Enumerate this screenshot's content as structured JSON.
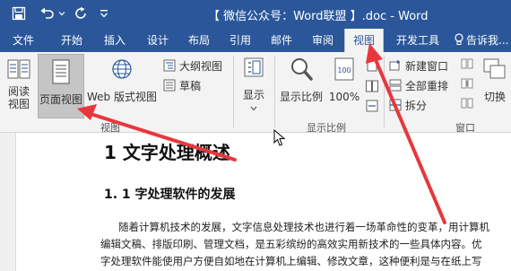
{
  "window": {
    "title": "【 微信公众号：Word联盟 】.doc - Word"
  },
  "tabs": [
    {
      "label": "文件"
    },
    {
      "label": "开始"
    },
    {
      "label": "插入"
    },
    {
      "label": "设计"
    },
    {
      "label": "布局"
    },
    {
      "label": "引用"
    },
    {
      "label": "邮件"
    },
    {
      "label": "审阅"
    },
    {
      "label": "视图"
    },
    {
      "label": "开发工具"
    },
    {
      "label": "告诉我..."
    }
  ],
  "ribbon": {
    "views": {
      "read_mode": [
        "阅读",
        "视图"
      ],
      "print_layout": "页面视图",
      "web_layout": "Web 版式视图",
      "outline": "大纲视图",
      "draft": "草稿",
      "group_label": "视图"
    },
    "show": {
      "show": "显示"
    },
    "zoom": {
      "zoom": "显示比例",
      "zoom_100": "100%",
      "group_label": "显示比例"
    },
    "window": {
      "new_window": "新建窗口",
      "arrange_all": "全部重排",
      "split": "拆分",
      "switch": "切换",
      "group_label": "窗口"
    }
  },
  "document": {
    "heading1": "1 文字处理概述",
    "heading2": "1. 1  字处理软件的发展",
    "paragraph_lines": [
      "随着计算机技术的发展，文字信息处理技术也进行着一场革命性的变革，用计算机",
      "编辑文稿、排版印刷、管理文档，是五彩缤纷的高效实用新技术的一些具体内容。优",
      "字处理软件能使用户方便自如地在计算机上编辑、修改文章，这种便利是与在纸上写"
    ]
  },
  "colors": {
    "title_bar": "#2b579a",
    "ribbon_bg": "#f3f3f3",
    "annotation_arrow": "#e8373c"
  }
}
